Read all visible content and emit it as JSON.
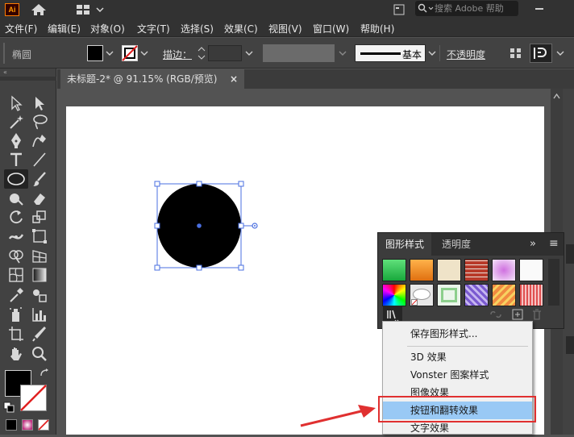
{
  "app": {
    "logo_text": "Ai",
    "search_placeholder": "搜索 Adobe 帮助"
  },
  "menu": [
    "文件(F)",
    "编辑(E)",
    "对象(O)",
    "文字(T)",
    "选择(S)",
    "效果(C)",
    "视图(V)",
    "窗口(W)",
    "帮助(H)"
  ],
  "controlbar": {
    "tool_name": "椭圆",
    "stroke_label": "描边：",
    "brush_label": "基本",
    "opacity_label": "不透明度"
  },
  "document": {
    "tab_title": "未标题-2* @ 91.15% (RGB/预览)",
    "close_glyph": "×"
  },
  "panel": {
    "tab_styles": "图形样式",
    "tab_transparency": "透明度",
    "collapse_glyph": "»",
    "menu_glyph": "≡"
  },
  "dropdown": {
    "items": [
      "保存图形样式...",
      "3D 效果",
      "Vonster 图案样式",
      "图像效果",
      "按钮和翻转效果",
      "文字效果"
    ]
  },
  "colors": {
    "accent_highlight": "#99c9f5",
    "annotation_red": "#e03030",
    "selection_blue": "#4a6fe0"
  }
}
